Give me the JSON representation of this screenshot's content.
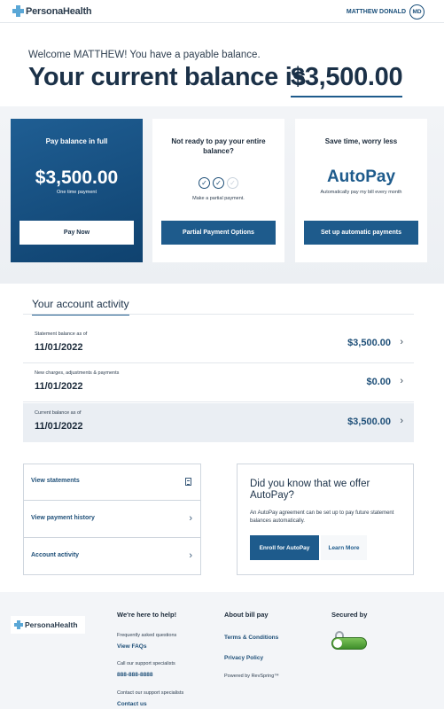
{
  "header": {
    "brand": "PersonaHealth",
    "user_name": "MATTHEW DONALD",
    "user_initials": "MD"
  },
  "hero": {
    "welcome": "Welcome MATTHEW! You have a payable balance.",
    "title": "Your current balance is",
    "amount": "$3,500.00"
  },
  "cards": {
    "full": {
      "title": "Pay balance in full",
      "amount": "$3,500.00",
      "sub": "One time payment",
      "button": "Pay Now"
    },
    "partial": {
      "title": "Not ready to pay your entire balance?",
      "sub": "Make a partial payment.",
      "button": "Partial Payment Options",
      "progress_steps_done": 2,
      "progress_steps_total": 3
    },
    "autopay": {
      "title": "Save time, worry less",
      "headline": "AutoPay",
      "sub": "Automatically pay my bill every month",
      "button": "Set up automatic payments"
    }
  },
  "activity": {
    "title": "Your account activity",
    "rows": [
      {
        "label": "Statement balance as of",
        "date": "11/01/2022",
        "amount": "$3,500.00"
      },
      {
        "label": "New charges, adjustments & payments",
        "date": "11/01/2022",
        "amount": "$0.00"
      },
      {
        "label": "Current balance as of",
        "date": "11/01/2022",
        "amount": "$3,500.00"
      }
    ]
  },
  "links": [
    {
      "label": "View statements",
      "icon": "document-icon"
    },
    {
      "label": "View payment history",
      "icon": "chevron-right-icon"
    },
    {
      "label": "Account activity",
      "icon": "chevron-right-icon"
    }
  ],
  "promo": {
    "title": "Did you know that we offer AutoPay?",
    "text": "An AutoPay agreement can be set up to pay future statement balances automatically.",
    "enroll": "Enroll for AutoPay",
    "learn": "Learn More"
  },
  "footer": {
    "brand": "PersonaHealth",
    "help_title": "We're here to help!",
    "faq_label": "Frequently asked questions",
    "faq_link": "View FAQs",
    "call_label": "Call our support specialists",
    "phone": "888-888-8888",
    "contact_label": "Contact our support specialists",
    "contact_link": "Contact us",
    "about_title": "About bill pay",
    "terms": "Terms & Conditions",
    "privacy": "Privacy Policy",
    "powered": "Powered by RevSpring™",
    "secured_title": "Secured by",
    "seal_icon": "secure-seal-icon"
  },
  "colors": {
    "primary": "#1e5b8c",
    "dark_text": "#1b3148",
    "band": "#f2f4f7"
  }
}
